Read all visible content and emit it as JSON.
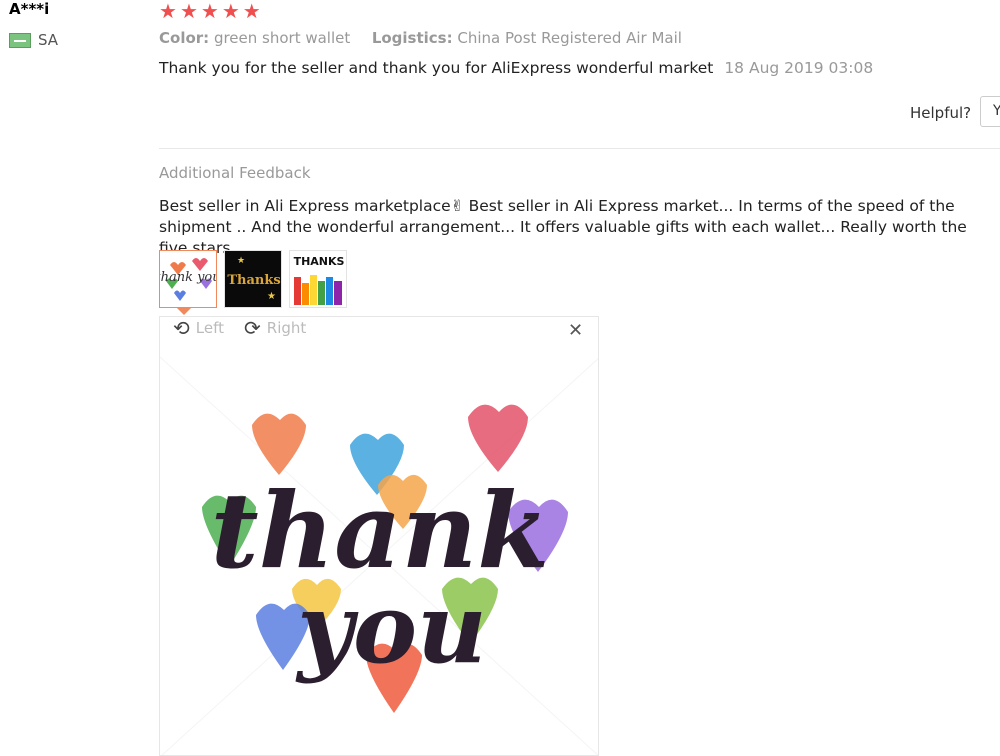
{
  "reviewer": {
    "name": "A***i",
    "country": "SA"
  },
  "rating": {
    "stars": 5,
    "max": 5
  },
  "meta": {
    "color_label": "Color:",
    "color_value": "green short wallet",
    "logistics_label": "Logistics:",
    "logistics_value": "China Post Registered Air Mail"
  },
  "review": {
    "text": "Thank you for the seller and thank you for AliExpress wonderful market",
    "date": "18 Aug 2019 03:08"
  },
  "helpful": {
    "label": "Helpful?",
    "button_label": "Y"
  },
  "additional": {
    "title": "Additional Feedback",
    "text": "Best seller in Ali Express marketplace✌ Best seller in Ali Express market... In terms of the speed of the shipment .. And the wonderful arrangement... It offers valuable gifts with each wallet... Really worth the five stars."
  },
  "thumbnails": [
    {
      "caption": "thank you"
    },
    {
      "caption": "Thanks"
    },
    {
      "caption": "THANKS"
    }
  ],
  "viewer": {
    "rotate_left_label": "Left",
    "rotate_right_label": "Right",
    "image_text_1": "thank",
    "image_text_2": "you"
  },
  "colors": {
    "star": "#ef4f4f",
    "accent": "#f08a5d"
  }
}
